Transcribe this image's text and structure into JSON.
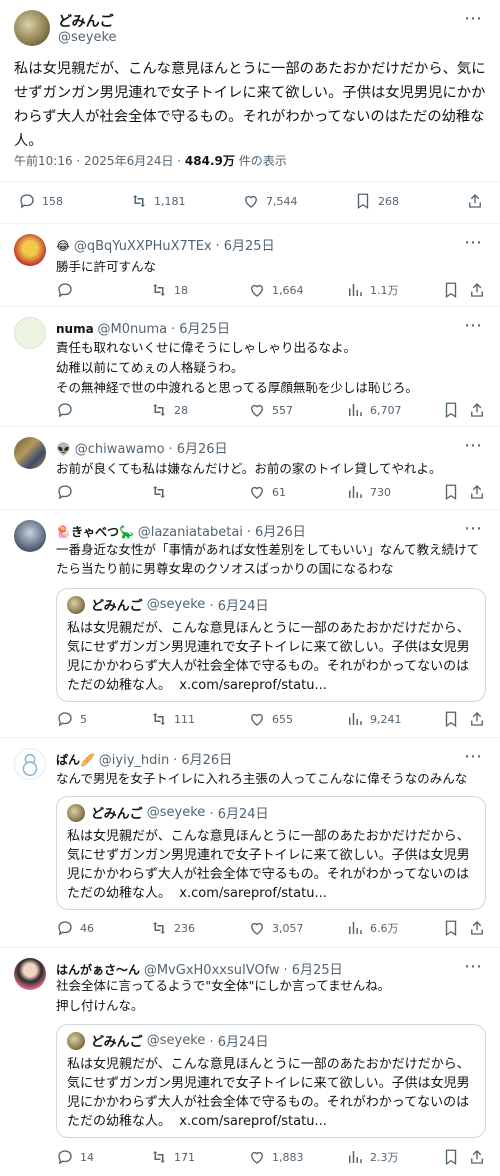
{
  "main": {
    "author_name": "どみんご",
    "author_handle": "@seyeke",
    "text": "私は女児親だが、こんな意見ほんとうに一部のあたおかだけだから、気にせずガンガン男児連れで女子トイレに来て欲しい。子供は女児男児にかかわらず大人が社会全体で守るもの。それがわかってないのはただの幼稚な人。",
    "timestamp": "午前10:16 · 2025年6月24日 · ",
    "views_count": "484.9万",
    "views_label": " 件の表示",
    "replies": "158",
    "retweets": "1,181",
    "likes": "7,544",
    "bookmarks": "268"
  },
  "replies": [
    {
      "name": "😂",
      "handle": "@qBqYuXXPHuX7TEx",
      "date": "· 6月25日",
      "text": "勝手に許可すんな",
      "reply_count": "",
      "retweets": "18",
      "likes": "1,664",
      "views": "1.1万"
    },
    {
      "name": "numa",
      "handle": "@M0numa",
      "date": "· 6月25日",
      "text": "責任も取れないくせに偉そうにしゃしゃり出るなよ。\n幼稚以前にてめぇの人格疑うわ。\nその無神経で世の中渡れると思ってる厚顔無恥を少しは恥じろ。",
      "reply_count": "",
      "retweets": "28",
      "likes": "557",
      "views": "6,707"
    },
    {
      "name": "👽",
      "handle": "@chiwawamo",
      "date": "· 6月26日",
      "text": "お前が良くても私は嫌なんだけど。お前の家のトイレ貸してやれよ。",
      "reply_count": "",
      "retweets": "",
      "likes": "61",
      "views": "730"
    },
    {
      "name": "🪼きゃべつ🦕",
      "handle": "@lazaniatabetai",
      "date": "· 6月26日",
      "text": "一番身近な女性が「事情があれば女性差別をしてもいい」なんて教え続けてたら当たり前に男尊女卑のクソオスばっかりの国になるわな",
      "reply_count": "5",
      "retweets": "111",
      "likes": "655",
      "views": "9,241"
    },
    {
      "name": "ぱん🥖",
      "handle": "@iyiy_hdin",
      "date": "· 6月26日",
      "text": "なんで男児を女子トイレに入れろ主張の人ってこんなに偉そうなのみんな",
      "reply_count": "46",
      "retweets": "236",
      "likes": "3,057",
      "views": "6.6万"
    },
    {
      "name": "はんがぁさ〜ん",
      "handle": "@MvGxH0xxsuIVOfw",
      "date": "· 6月25日",
      "text": "社会全体に言ってるようで\"女全体\"にしか言ってませんね。\n押し付けんな。",
      "reply_count": "14",
      "retweets": "171",
      "likes": "1,883",
      "views": "2.3万"
    }
  ],
  "quote": {
    "name": "どみんご",
    "handle": "@seyeke",
    "date": "· 6月24日",
    "text": "私は女児親だが、こんな意見ほんとうに一部のあたおかだけだから、気にせずガンガン男児連れで女子トイレに来て欲しい。子供は女児男児にかかわらず大人が社会全体で守るもの。それがわかってないのはただの幼稚な人。",
    "link": "x.com/sareprof/statu..."
  },
  "more_symbol": "⋯"
}
